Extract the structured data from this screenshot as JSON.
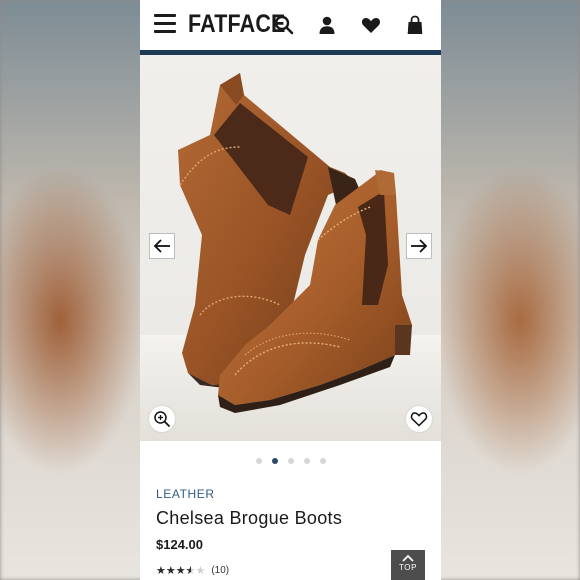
{
  "header": {
    "brand": "FATFACE",
    "menu_icon": "hamburger-menu-icon",
    "icons": [
      "search-icon",
      "account-icon",
      "heart-icon",
      "shopping-bag-icon"
    ],
    "accent_color": "#1f3a56"
  },
  "gallery": {
    "prev_icon": "arrow-left-icon",
    "next_icon": "arrow-right-icon",
    "zoom_icon": "zoom-in-icon",
    "favorite_icon": "heart-outline-icon",
    "slide_count": 5,
    "active_slide": 2
  },
  "product": {
    "category": "LEATHER",
    "title": "Chelsea Brogue Boots",
    "price": "$124.00",
    "rating": 3.5,
    "rating_max": 5,
    "review_count": "(10)"
  },
  "back_to_top": {
    "label": "TOP",
    "icon": "chevron-up-icon"
  }
}
